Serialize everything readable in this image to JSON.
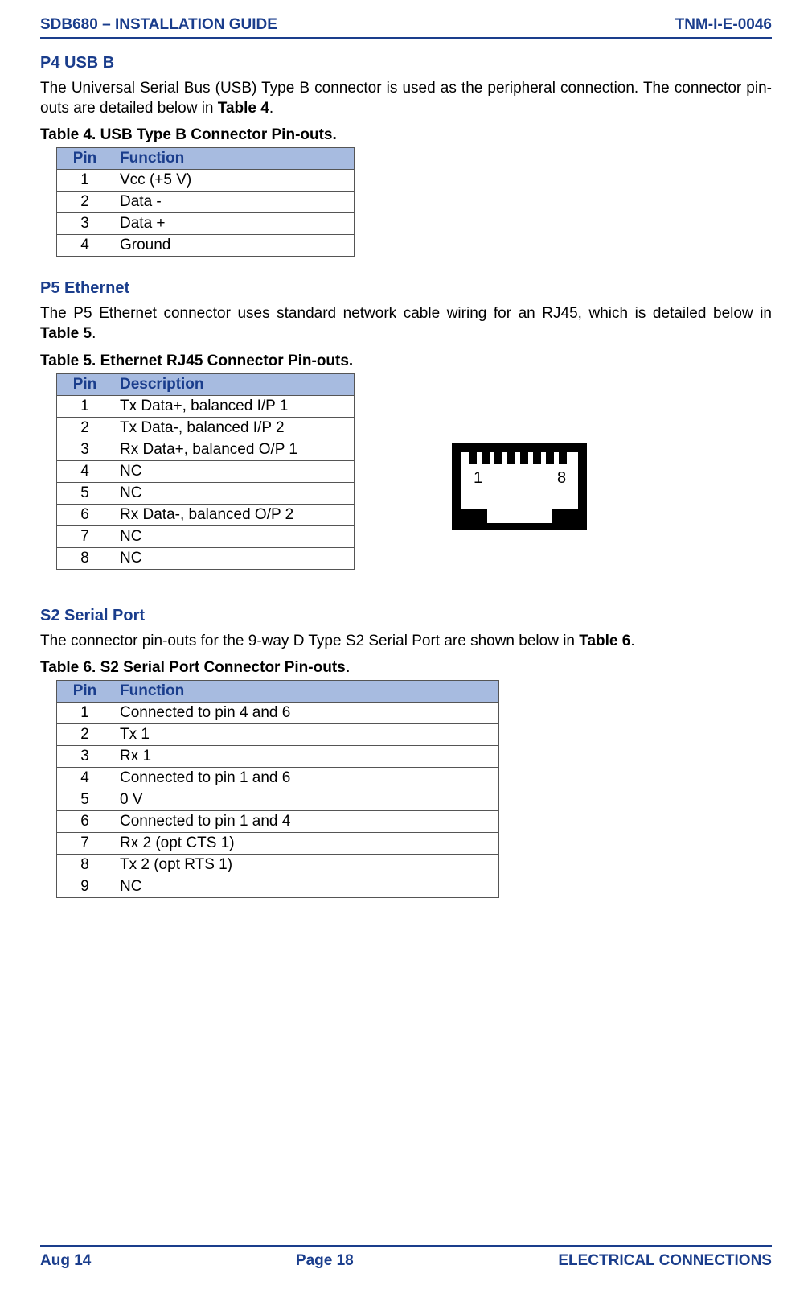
{
  "header": {
    "left": "SDB680 – INSTALLATION GUIDE",
    "right": "TNM-I-E-0046"
  },
  "sections": {
    "usb": {
      "title": "P4 USB B",
      "body_prefix": "The Universal Serial Bus (USB) Type B connector is used as the peripheral connection.   The connector pin-outs are detailed below in ",
      "body_bold": "Table 4",
      "body_suffix": ".",
      "table_caption": "Table 4.  USB Type B Connector Pin-outs.",
      "header_pin": "Pin",
      "header_func": "Function",
      "rows": [
        {
          "pin": "1",
          "func": "Vcc (+5 V)"
        },
        {
          "pin": "2",
          "func": "Data -"
        },
        {
          "pin": "3",
          "func": "Data +"
        },
        {
          "pin": "4",
          "func": "Ground"
        }
      ]
    },
    "ethernet": {
      "title": "P5 Ethernet",
      "body_prefix": "The P5 Ethernet connector uses standard network cable wiring for an RJ45, which is detailed below in ",
      "body_bold": "Table 5",
      "body_suffix": ".",
      "table_caption": "Table 5.  Ethernet RJ45 Connector Pin-outs.",
      "header_pin": "Pin",
      "header_func": "Description",
      "rows": [
        {
          "pin": "1",
          "func": "Tx Data+, balanced I/P 1"
        },
        {
          "pin": "2",
          "func": "Tx Data-, balanced I/P 2"
        },
        {
          "pin": "3",
          "func": "Rx Data+, balanced O/P 1"
        },
        {
          "pin": "4",
          "func": "NC"
        },
        {
          "pin": "5",
          "func": "NC"
        },
        {
          "pin": "6",
          "func": "Rx Data-, balanced O/P 2"
        },
        {
          "pin": "7",
          "func": "NC"
        },
        {
          "pin": "8",
          "func": "NC"
        }
      ],
      "svg_label_1": "1",
      "svg_label_8": "8"
    },
    "serial": {
      "title": "S2 Serial Port",
      "body_prefix": "The connector pin-outs for the 9-way D Type S2 Serial Port are shown below in ",
      "body_bold": "Table 6",
      "body_suffix": ".",
      "table_caption": "Table 6.  S2 Serial Port Connector Pin-outs.",
      "header_pin": "Pin",
      "header_func": "Function",
      "rows": [
        {
          "pin": "1",
          "func": "Connected to pin 4 and 6"
        },
        {
          "pin": "2",
          "func": "Tx 1"
        },
        {
          "pin": "3",
          "func": "Rx 1"
        },
        {
          "pin": "4",
          "func": "Connected to pin 1 and 6"
        },
        {
          "pin": "5",
          "func": "0 V"
        },
        {
          "pin": "6",
          "func": "Connected to pin 1 and 4"
        },
        {
          "pin": "7",
          "func": "Rx 2 (opt CTS 1)"
        },
        {
          "pin": "8",
          "func": "Tx 2 (opt RTS 1)"
        },
        {
          "pin": "9",
          "func": "NC"
        }
      ]
    }
  },
  "footer": {
    "left": "Aug 14",
    "center": "Page 18",
    "right": "ELECTRICAL CONNECTIONS"
  }
}
